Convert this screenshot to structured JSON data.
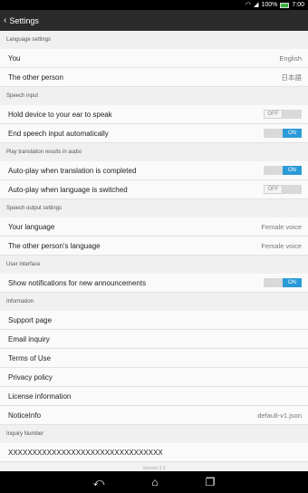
{
  "status_bar": {
    "battery_percent": "100%",
    "time": "7:00"
  },
  "action_bar": {
    "title": "Settings"
  },
  "language_settings": {
    "header": "Language settings",
    "you_label": "You",
    "you_value": "English",
    "other_label": "The other person",
    "other_value": "日本語"
  },
  "speech_input": {
    "header": "Speech input",
    "hold_label": "Hold device to your ear to speak",
    "hold_state": "OFF",
    "end_label": "End speech input automatically",
    "end_state": "ON"
  },
  "play_translation": {
    "header": "Play translation results in audio",
    "autoplay_completed_label": "Auto-play when translation is completed",
    "autoplay_completed_state": "ON",
    "autoplay_switched_label": "Auto-play when language is switched",
    "autoplay_switched_state": "OFF"
  },
  "speech_output": {
    "header": "Speech output settings",
    "your_label": "Your language",
    "your_value": "Female voice",
    "other_label": "The other person's language",
    "other_value": "Female voice"
  },
  "user_interface": {
    "header": "User interface",
    "notify_label": "Show notifications for new announcements",
    "notify_state": "ON"
  },
  "information": {
    "header": "Information",
    "support": "Support page",
    "email": "Email inquiry",
    "terms": "Terms of Use",
    "privacy": "Privacy policy",
    "license": "License information",
    "notice_label": "NoticeInfo",
    "notice_value": "default-v1.json"
  },
  "inquiry": {
    "header": "Inquiry Number",
    "value": "XXXXXXXXXXXXXXXXXXXXXXXXXXXXXXXX"
  },
  "version_text": "Version 3.3",
  "icons": {
    "back": "chevron-left-icon",
    "wifi": "wifi-icon",
    "signal": "signal-icon",
    "battery": "battery-icon",
    "nav_back": "back-arrow-icon",
    "nav_home": "home-icon",
    "nav_recents": "recents-icon"
  }
}
